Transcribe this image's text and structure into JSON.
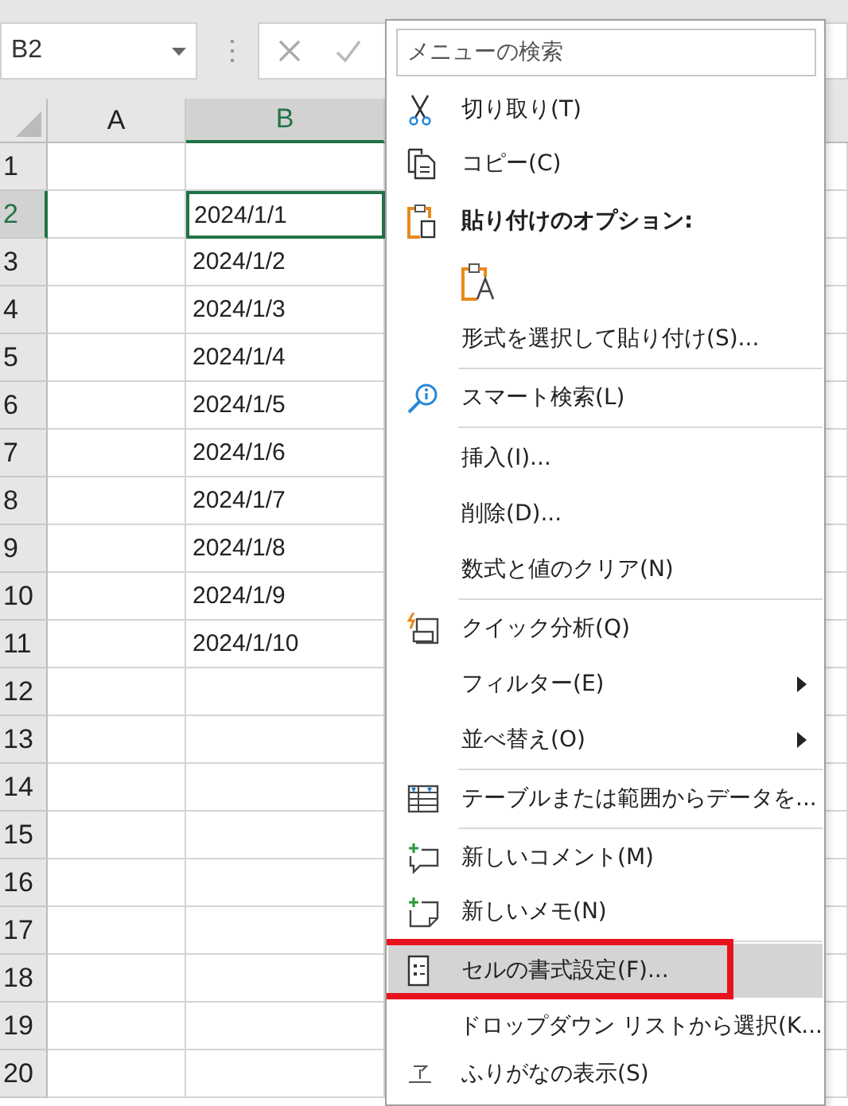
{
  "name_box": {
    "value": "B2"
  },
  "sheet": {
    "columns": [
      {
        "label": "A",
        "selected": false
      },
      {
        "label": "B",
        "selected": true
      }
    ],
    "rows": [
      {
        "label": "1",
        "selected": false
      },
      {
        "label": "2",
        "selected": true,
        "b": "2024/1/1"
      },
      {
        "label": "3",
        "selected": false,
        "b": "2024/1/2"
      },
      {
        "label": "4",
        "selected": false,
        "b": "2024/1/3"
      },
      {
        "label": "5",
        "selected": false,
        "b": "2024/1/4"
      },
      {
        "label": "6",
        "selected": false,
        "b": "2024/1/5"
      },
      {
        "label": "7",
        "selected": false,
        "b": "2024/1/6"
      },
      {
        "label": "8",
        "selected": false,
        "b": "2024/1/7"
      },
      {
        "label": "9",
        "selected": false,
        "b": "2024/1/8"
      },
      {
        "label": "10",
        "selected": false,
        "b": "2024/1/9"
      },
      {
        "label": "11",
        "selected": false,
        "b": "2024/1/10"
      },
      {
        "label": "12",
        "selected": false
      },
      {
        "label": "13",
        "selected": false
      },
      {
        "label": "14",
        "selected": false
      },
      {
        "label": "15",
        "selected": false
      },
      {
        "label": "16",
        "selected": false
      },
      {
        "label": "17",
        "selected": false
      },
      {
        "label": "18",
        "selected": false
      },
      {
        "label": "19",
        "selected": false
      },
      {
        "label": "20",
        "selected": false
      }
    ]
  },
  "context_menu": {
    "search": {
      "placeholder": "メニューの検索"
    },
    "items": [
      {
        "kind": "cut",
        "label": "切り取り(T)",
        "selected": false,
        "boxed": false
      },
      {
        "kind": "copy",
        "label": "コピー(C)",
        "selected": false,
        "boxed": false
      },
      {
        "kind": "paste-header",
        "label": "貼り付けのオプション:",
        "selected": false,
        "boxed": false
      },
      {
        "kind": "paste-option",
        "selected": false
      },
      {
        "kind": "plain",
        "label": "形式を選択して貼り付け(S)...",
        "selected": false,
        "boxed": false
      },
      {
        "kind": "separator"
      },
      {
        "kind": "lookup",
        "label": "スマート検索(L)",
        "selected": false,
        "boxed": false
      },
      {
        "kind": "separator"
      },
      {
        "kind": "plain",
        "label": "挿入(I)...",
        "selected": false,
        "boxed": false
      },
      {
        "kind": "plain",
        "label": "削除(D)...",
        "selected": false,
        "boxed": false
      },
      {
        "kind": "plain",
        "label": "数式と値のクリア(N)",
        "selected": false,
        "boxed": false
      },
      {
        "kind": "separator"
      },
      {
        "kind": "analysis",
        "label": "クイック分析(Q)",
        "selected": false,
        "boxed": false
      },
      {
        "kind": "submenu",
        "label": "フィルター(E)",
        "selected": false,
        "boxed": false
      },
      {
        "kind": "submenu",
        "label": "並べ替え(O)",
        "selected": false,
        "boxed": false
      },
      {
        "kind": "separator"
      },
      {
        "kind": "table",
        "label": "テーブルまたは範囲からデータを...",
        "selected": false,
        "boxed": false
      },
      {
        "kind": "separator"
      },
      {
        "kind": "comment",
        "label": "新しいコメント(M)",
        "selected": false,
        "boxed": false
      },
      {
        "kind": "memo",
        "label": "新しいメモ(N)",
        "selected": false,
        "boxed": false
      },
      {
        "kind": "separator"
      },
      {
        "kind": "format",
        "label": "セルの書式設定(F)...",
        "selected": true,
        "boxed": true
      },
      {
        "kind": "plain",
        "label": "ドロップダウン リストから選択(K...",
        "selected": false,
        "boxed": false
      },
      {
        "kind": "furigana",
        "label": "ふりがなの表示(S)",
        "selected": false,
        "boxed": false
      }
    ]
  }
}
